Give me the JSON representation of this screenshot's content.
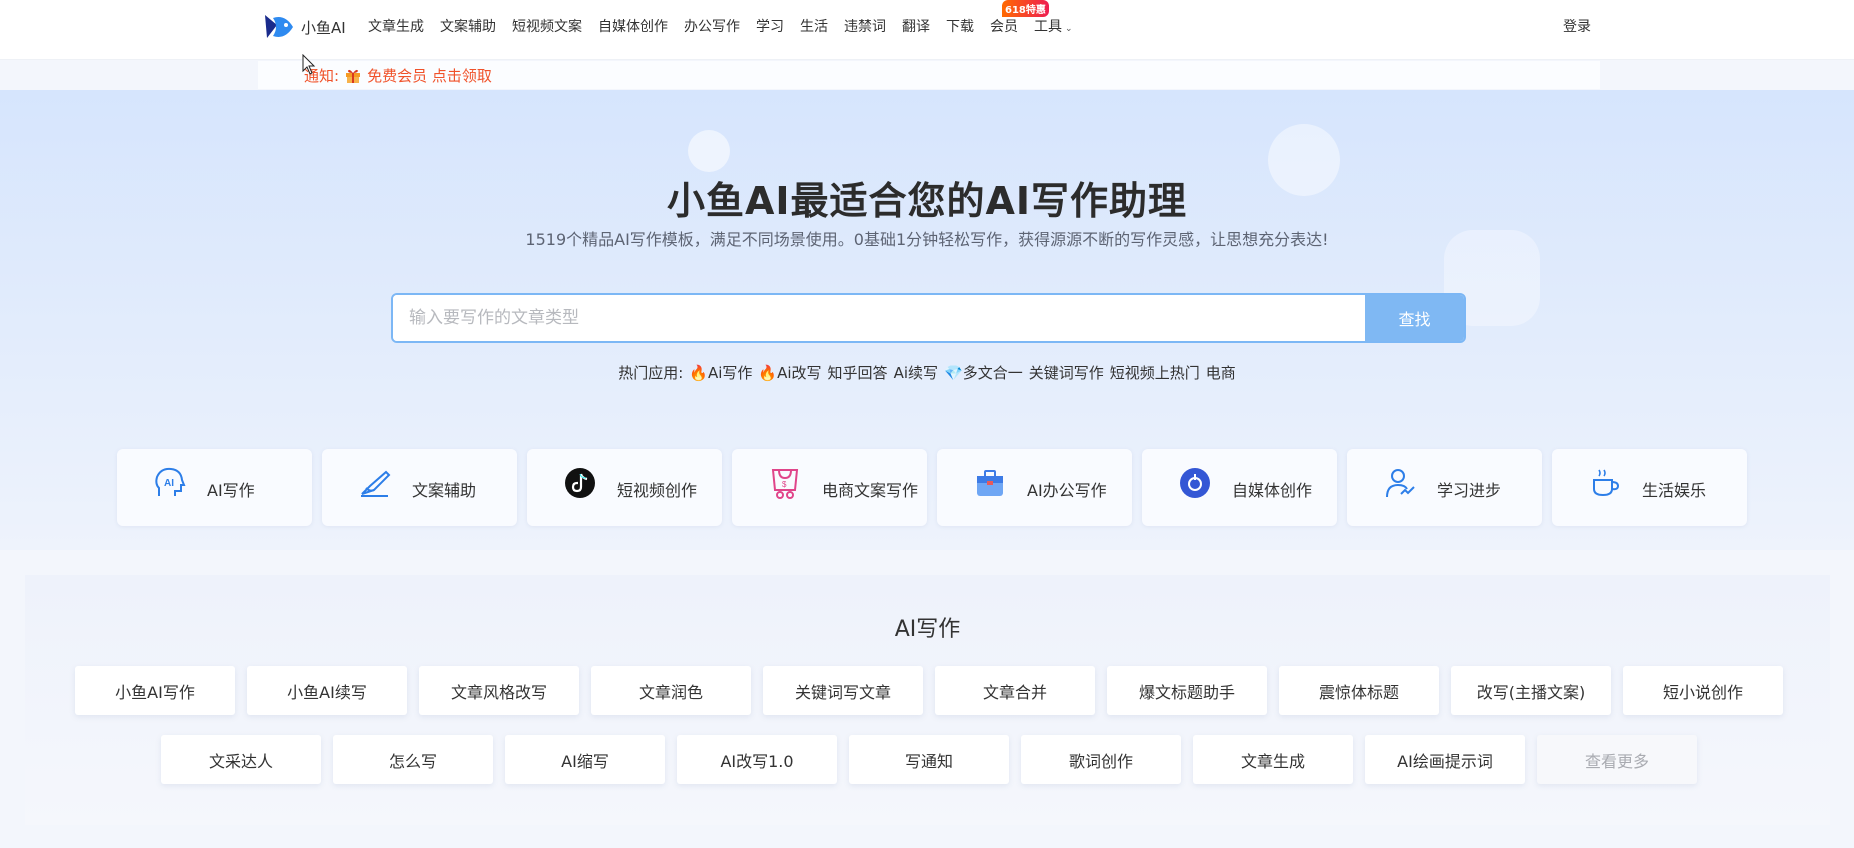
{
  "header": {
    "logo_text": "小鱼AI",
    "nav": [
      {
        "label": "文章生成"
      },
      {
        "label": "文案辅助"
      },
      {
        "label": "短视频文案"
      },
      {
        "label": "自媒体创作"
      },
      {
        "label": "办公写作"
      },
      {
        "label": "学习"
      },
      {
        "label": "生活"
      },
      {
        "label": "违禁词"
      },
      {
        "label": "翻译"
      },
      {
        "label": "下载"
      },
      {
        "label": "会员",
        "badge": "618特惠"
      },
      {
        "label": "工具"
      }
    ],
    "login": "登录"
  },
  "notice": {
    "prefix": "通知:",
    "text": "免费会员 点击领取"
  },
  "hero": {
    "title": "小鱼AI最适合您的AI写作助理",
    "subtitle": "1519个精品AI写作模板，满足不同场景使用。0基础1分钟轻松写作，获得源源不断的写作灵感，让思想充分表达!",
    "search_placeholder": "输入要写作的文章类型",
    "search_button": "查找",
    "hot_label": "热门应用:",
    "hot_items": [
      "Ai写作",
      "Ai改写",
      "知乎回答",
      "Ai续写",
      "多文合一",
      "关键词写作",
      "短视频上热门",
      "电商"
    ]
  },
  "categories": [
    {
      "label": "AI写作",
      "icon": "ai-head-icon"
    },
    {
      "label": "文案辅助",
      "icon": "pen-hand-icon"
    },
    {
      "label": "短视频创作",
      "icon": "tiktok-icon"
    },
    {
      "label": "电商文案写作",
      "icon": "shopping-bag-icon"
    },
    {
      "label": "AI办公写作",
      "icon": "briefcase-icon"
    },
    {
      "label": "自媒体创作",
      "icon": "media-icon"
    },
    {
      "label": "学习进步",
      "icon": "learner-icon"
    },
    {
      "label": "生活娱乐",
      "icon": "coffee-icon"
    }
  ],
  "section": {
    "title": "AI写作",
    "row1": [
      "小鱼AI写作",
      "小鱼AI续写",
      "文章风格改写",
      "文章润色",
      "关键词写文章",
      "文章合并",
      "爆文标题助手",
      "震惊体标题",
      "改写(主播文案)",
      "短小说创作"
    ],
    "row2": [
      "文采达人",
      "怎么写",
      "AI缩写",
      "AI改写1.0",
      "写通知",
      "歌词创作",
      "文章生成",
      "AI绘画提示词"
    ],
    "more": "查看更多"
  },
  "colors": {
    "accent": "#3d8ef0",
    "notice": "#f0522a",
    "search_button": "#7fb8f3",
    "badge": "#ee1d52"
  }
}
